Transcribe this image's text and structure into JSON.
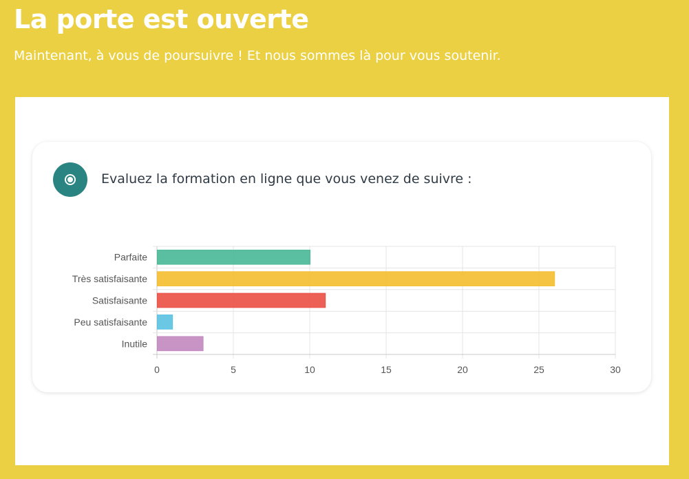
{
  "header": {
    "title": "La porte est ouverte",
    "subtitle": "Maintenant, à vous de poursuivre ! Et nous sommes là pour vous soutenir."
  },
  "question": {
    "icon": "radio-button-icon",
    "text": "Evaluez la formation en ligne que vous venez de suivre :"
  },
  "colors": {
    "background": "#ebd043",
    "accent": "#2a8582"
  },
  "chart_data": {
    "type": "bar",
    "orientation": "horizontal",
    "categories": [
      "Parfaite",
      "Très satisfaisante",
      "Satisfaisante",
      "Peu satisfaisante",
      "Inutile"
    ],
    "values": [
      10,
      26,
      11,
      1,
      3
    ],
    "colors": [
      "#4cba98",
      "#f4bf33",
      "#ec5247",
      "#5dc3e3",
      "#c38bc0"
    ],
    "xlim": [
      0,
      30
    ],
    "xticks": [
      0,
      5,
      10,
      15,
      20,
      25,
      30
    ],
    "grid": true,
    "legend": "none"
  }
}
